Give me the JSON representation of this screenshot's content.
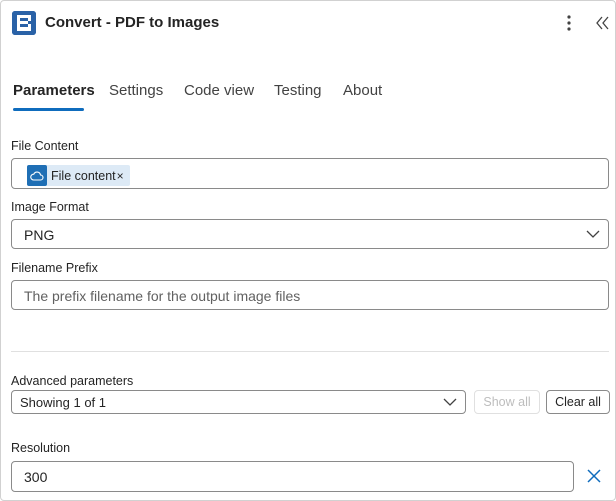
{
  "header": {
    "title": "Convert - PDF to Images",
    "icons": {
      "logo": "app-logo-icon",
      "more": "more-vertical-icon",
      "collapse": "double-chevron-left-icon"
    }
  },
  "tabs": [
    {
      "label": "Parameters",
      "active": true
    },
    {
      "label": "Settings",
      "active": false
    },
    {
      "label": "Code view",
      "active": false
    },
    {
      "label": "Testing",
      "active": false
    },
    {
      "label": "About",
      "active": false
    }
  ],
  "fields": {
    "file_content": {
      "label": "File Content",
      "token_label": "File content",
      "token_remove": "×",
      "token_icon": "cloud-icon"
    },
    "image_format": {
      "label": "Image Format",
      "value": "PNG"
    },
    "filename_prefix": {
      "label": "Filename Prefix",
      "placeholder": "The prefix filename for the output image files"
    }
  },
  "advanced": {
    "label": "Advanced parameters",
    "selected": "Showing 1 of 1",
    "show_all_label": "Show all",
    "clear_all_label": "Clear all"
  },
  "resolution": {
    "label": "Resolution",
    "value": "300"
  },
  "colors": {
    "accent": "#0f6cbd",
    "token_bg": "#ddeaf6",
    "token_icon_bg": "#1f6fb5",
    "logo_bg": "#2a62a7"
  }
}
